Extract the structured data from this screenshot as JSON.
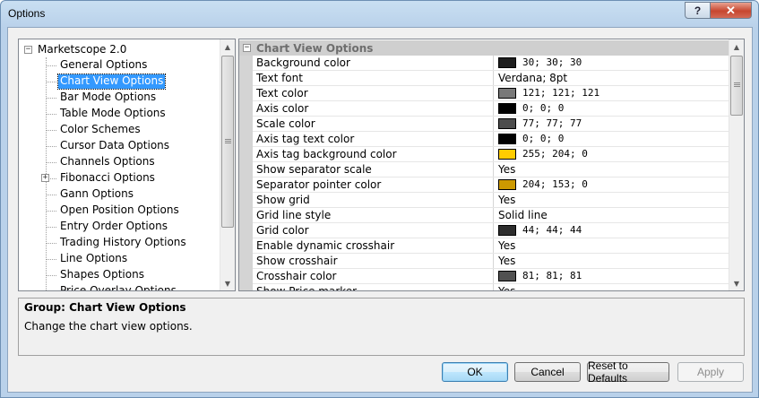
{
  "window": {
    "title": "Options",
    "help_label": "?",
    "close_label": "✕"
  },
  "tree": {
    "root_label": "Marketscope 2.0",
    "root_expander": "−",
    "items": [
      {
        "label": "General Options",
        "selected": false,
        "expander": ""
      },
      {
        "label": "Chart View Options",
        "selected": true,
        "expander": ""
      },
      {
        "label": "Bar Mode Options",
        "selected": false,
        "expander": ""
      },
      {
        "label": "Table Mode Options",
        "selected": false,
        "expander": ""
      },
      {
        "label": "Color Schemes",
        "selected": false,
        "expander": ""
      },
      {
        "label": "Cursor Data Options",
        "selected": false,
        "expander": ""
      },
      {
        "label": "Channels Options",
        "selected": false,
        "expander": ""
      },
      {
        "label": "Fibonacci Options",
        "selected": false,
        "expander": "+"
      },
      {
        "label": "Gann Options",
        "selected": false,
        "expander": ""
      },
      {
        "label": "Open Position Options",
        "selected": false,
        "expander": ""
      },
      {
        "label": "Entry Order Options",
        "selected": false,
        "expander": ""
      },
      {
        "label": "Trading History Options",
        "selected": false,
        "expander": ""
      },
      {
        "label": "Line Options",
        "selected": false,
        "expander": ""
      },
      {
        "label": "Shapes Options",
        "selected": false,
        "expander": ""
      },
      {
        "label": "Price Overlay Options",
        "selected": false,
        "expander": ""
      }
    ]
  },
  "grid": {
    "category_label": "Chart View Options",
    "category_expander": "−",
    "rows": [
      {
        "name": "Background color",
        "value": "30; 30; 30",
        "swatch": "#1e1e1e"
      },
      {
        "name": "Text font",
        "value": "Verdana; 8pt",
        "swatch": null
      },
      {
        "name": "Text color",
        "value": "121; 121; 121",
        "swatch": "#797979"
      },
      {
        "name": "Axis color",
        "value": "0; 0; 0",
        "swatch": "#000000"
      },
      {
        "name": "Scale color",
        "value": "77; 77; 77",
        "swatch": "#4d4d4d"
      },
      {
        "name": "Axis tag text color",
        "value": "0; 0; 0",
        "swatch": "#000000"
      },
      {
        "name": "Axis tag background color",
        "value": "255; 204; 0",
        "swatch": "#ffcc00"
      },
      {
        "name": "Show separator scale",
        "value": "Yes",
        "swatch": null
      },
      {
        "name": "Separator pointer color",
        "value": "204; 153; 0",
        "swatch": "#cc9900"
      },
      {
        "name": "Show grid",
        "value": "Yes",
        "swatch": null
      },
      {
        "name": "Grid line style",
        "value": "Solid line",
        "swatch": null
      },
      {
        "name": "Grid color",
        "value": "44; 44; 44",
        "swatch": "#2c2c2c"
      },
      {
        "name": "Enable dynamic crosshair",
        "value": "Yes",
        "swatch": null
      },
      {
        "name": "Show crosshair",
        "value": "Yes",
        "swatch": null
      },
      {
        "name": "Crosshair color",
        "value": "81; 81; 81",
        "swatch": "#515151"
      },
      {
        "name": "Show Price marker",
        "value": "Yes",
        "swatch": null
      }
    ]
  },
  "description": {
    "title": "Group: Chart View Options",
    "text": "Change the chart view options."
  },
  "buttons": {
    "ok": "OK",
    "cancel": "Cancel",
    "reset": "Reset to Defaults",
    "apply": "Apply"
  },
  "scrollbar": {
    "up_arrow": "▲",
    "down_arrow": "▼"
  }
}
